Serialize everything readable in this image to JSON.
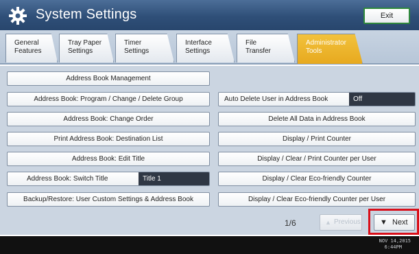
{
  "header": {
    "title": "System Settings",
    "exit_label": "Exit",
    "icon": "gear-icon"
  },
  "tabs": [
    {
      "label": "General\nFeatures",
      "active": false
    },
    {
      "label": "Tray Paper\nSettings",
      "active": false
    },
    {
      "label": "Timer\nSettings",
      "active": false
    },
    {
      "label": "Interface\nSettings",
      "active": false
    },
    {
      "label": "File\nTransfer",
      "active": false
    },
    {
      "label": "Administrator\nTools",
      "active": true
    }
  ],
  "left_buttons": [
    {
      "label": "Address Book Management"
    },
    {
      "label": "Address Book: Program / Change / Delete Group"
    },
    {
      "label": "Address Book: Change Order"
    },
    {
      "label": "Print Address Book: Destination List"
    },
    {
      "label": "Address Book: Edit Title"
    },
    {
      "label": "Address Book: Switch Title",
      "value": "Title 1"
    },
    {
      "label": "Backup/Restore: User Custom Settings & Address Book"
    }
  ],
  "right_buttons": [
    {
      "label": "Auto Delete User in Address Book",
      "value": "Off"
    },
    {
      "label": "Delete All Data in Address Book"
    },
    {
      "label": "Display / Print Counter"
    },
    {
      "label": "Display / Clear / Print Counter per User"
    },
    {
      "label": "Display / Clear Eco-friendly Counter"
    },
    {
      "label": "Display / Clear Eco-friendly Counter per User"
    }
  ],
  "pagination": {
    "page_indicator": "1/6",
    "previous_label": "Previous",
    "next_label": "Next"
  },
  "status": {
    "date": "NOV 14,2015",
    "time": "6:44PM"
  },
  "colors": {
    "header": "#2f4f78",
    "active_tab": "#e7a91f",
    "highlight": "#d90f1a",
    "exit_border": "#2e8a3a"
  }
}
